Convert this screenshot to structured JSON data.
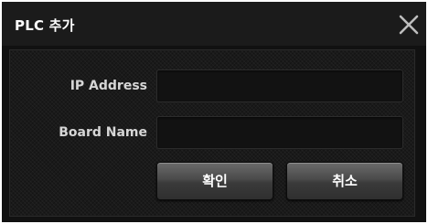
{
  "dialog": {
    "title": "PLC 추가",
    "close_icon": "close-x-icon"
  },
  "form": {
    "ip_label": "IP Address",
    "ip_value": "",
    "board_label": "Board Name",
    "board_value": ""
  },
  "buttons": {
    "ok_label": "확인",
    "cancel_label": "취소"
  },
  "colors": {
    "dialog_bg": "#111111",
    "titlebar_bg": "#1b1b1b",
    "label_text": "#d6d6d6",
    "button_text": "#ffffff"
  }
}
